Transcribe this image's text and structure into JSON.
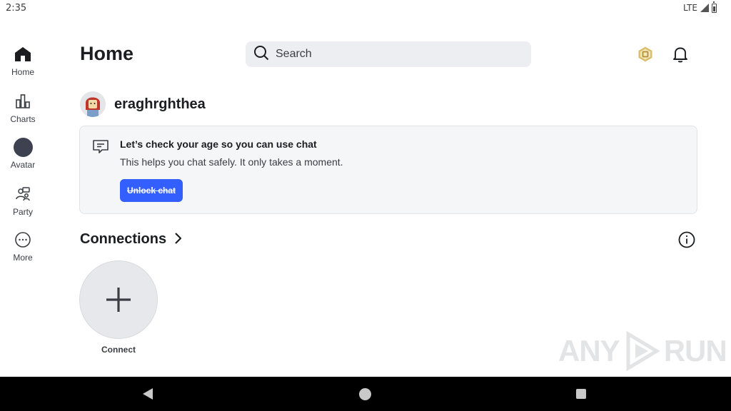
{
  "status_bar": {
    "time": "2:35",
    "network": "LTE"
  },
  "sidebar": {
    "items": [
      {
        "id": "home",
        "label": "Home",
        "icon": "home-icon",
        "active": true
      },
      {
        "id": "charts",
        "label": "Charts",
        "icon": "charts-icon"
      },
      {
        "id": "avatar",
        "label": "Avatar",
        "icon": "avatar-icon"
      },
      {
        "id": "party",
        "label": "Party",
        "icon": "party-icon"
      },
      {
        "id": "more",
        "label": "More",
        "icon": "more-icon"
      }
    ]
  },
  "header": {
    "title": "Home",
    "search_placeholder": "Search",
    "robux_icon": "robux-icon",
    "notifications_icon": "bell-icon"
  },
  "profile": {
    "username": "eraghrghthea"
  },
  "age_check": {
    "title": "Let’s check your age so you can use chat",
    "description": "This helps you chat safely. It only takes a moment.",
    "button_label": "Unlock chat"
  },
  "connections": {
    "title": "Connections",
    "connect_label": "Connect"
  },
  "watermark": {
    "text_left": "ANY",
    "text_right": "RUN"
  },
  "colors": {
    "accent": "#335fff",
    "card_bg": "#f5f6f8",
    "search_bg": "#eceef1",
    "text_primary": "#1b1d21",
    "robux_gold": "#c9a64a"
  }
}
